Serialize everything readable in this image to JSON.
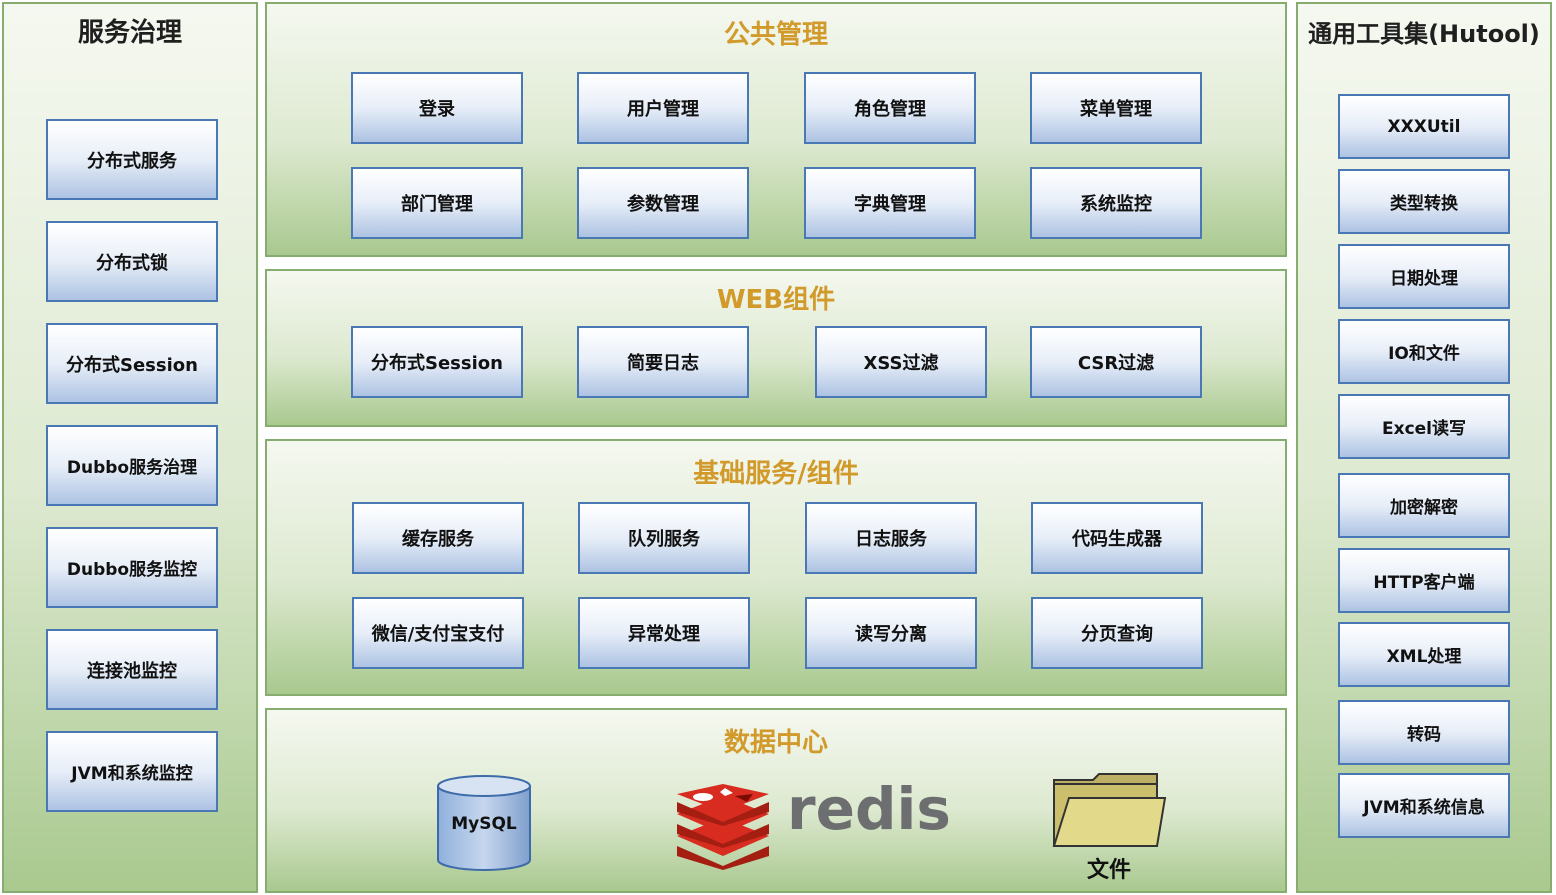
{
  "left_panel": {
    "title": "服务治理",
    "items": [
      "分布式服务",
      "分布式锁",
      "分布式Session",
      "Dubbo服务治理",
      "Dubbo服务监控",
      "连接池监控",
      "JVM和系统监控"
    ]
  },
  "public_mgmt": {
    "title": "公共管理",
    "items": [
      "登录",
      "用户管理",
      "角色管理",
      "菜单管理",
      "部门管理",
      "参数管理",
      "字典管理",
      "系统监控"
    ]
  },
  "web_components": {
    "title": "WEB组件",
    "items": [
      "分布式Session",
      "简要日志",
      "XSS过滤",
      "CSR过滤"
    ]
  },
  "base_services": {
    "title": "基础服务/组件",
    "items": [
      "缓存服务",
      "队列服务",
      "日志服务",
      "代码生成器",
      "微信/支付宝支付",
      "异常处理",
      "读写分离",
      "分页查询"
    ]
  },
  "data_center": {
    "title": "数据中心",
    "mysql_label": "MySQL",
    "redis_label": "redis",
    "file_label": "文件",
    "icons": [
      "database-cylinder-icon",
      "redis-logo-icon",
      "folder-icon"
    ]
  },
  "right_panel": {
    "title": "通用工具集(Hutool)",
    "items": [
      "XXXUtil",
      "类型转换",
      "日期处理",
      "IO和文件",
      "Excel读写",
      "加密解密",
      "HTTP客户端",
      "XML处理",
      "转码",
      "JVM和系统信息"
    ]
  },
  "colors": {
    "panel_border": "#86ad6f",
    "box_border": "#4a78b4",
    "gold_title": "#d19a2a",
    "redis_red": "#d82c20",
    "redis_text": "#6d6e70",
    "folder": "#cbbf6e"
  }
}
